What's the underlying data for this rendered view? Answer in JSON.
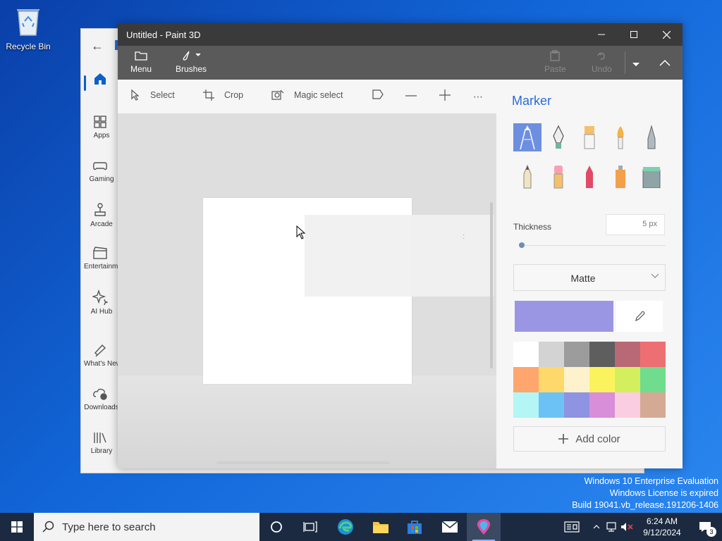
{
  "desktop": {
    "recycle_bin_label": "Recycle Bin",
    "watermark": {
      "line1": "Windows 10 Enterprise Evaluation",
      "line2": "Windows License is expired",
      "line3": "Build 19041.vb_release.191206-1406"
    }
  },
  "store_window": {
    "nav": [
      {
        "label": "Apps",
        "icon": "apps-icon"
      },
      {
        "label": "Gaming",
        "icon": "gamepad-icon"
      },
      {
        "label": "Arcade",
        "icon": "joystick-icon"
      },
      {
        "label": "Entertainment",
        "icon": "clapper-icon"
      },
      {
        "label": "AI Hub",
        "icon": "sparkle-icon"
      },
      {
        "label": "What's New",
        "icon": "megaphone-icon"
      },
      {
        "label": "Downloads",
        "icon": "cloud-download-icon"
      },
      {
        "label": "Library",
        "icon": "library-icon"
      }
    ]
  },
  "paint": {
    "title": "Untitled - Paint 3D",
    "ribbon": {
      "menu_label": "Menu",
      "brushes_label": "Brushes",
      "paste_label": "Paste",
      "undo_label": "Undo"
    },
    "toolbar": {
      "select_label": "Select",
      "crop_label": "Crop",
      "magic_select_label": "Magic select"
    },
    "panel": {
      "title": "Marker",
      "thickness_label": "Thickness",
      "thickness_value": "5 px",
      "finish_value": "Matte",
      "add_color_label": "Add color",
      "selected_color": "#9b96e4",
      "palette": [
        "#ffffff",
        "#d3d3d3",
        "#9c9c9c",
        "#5e5e5e",
        "#b96975",
        "#ee6f73",
        "#ffa66e",
        "#ffd86b",
        "#fdf2cc",
        "#fbf35e",
        "#d4ef5e",
        "#6fdc8e",
        "#b4f5f5",
        "#6cc2f5",
        "#8e94e2",
        "#d88ed8",
        "#fbcde0",
        "#d4aa94"
      ]
    }
  },
  "taskbar": {
    "search_placeholder": "Type here to search",
    "time": "6:24 AM",
    "date": "9/12/2024",
    "notification_count": "3"
  }
}
